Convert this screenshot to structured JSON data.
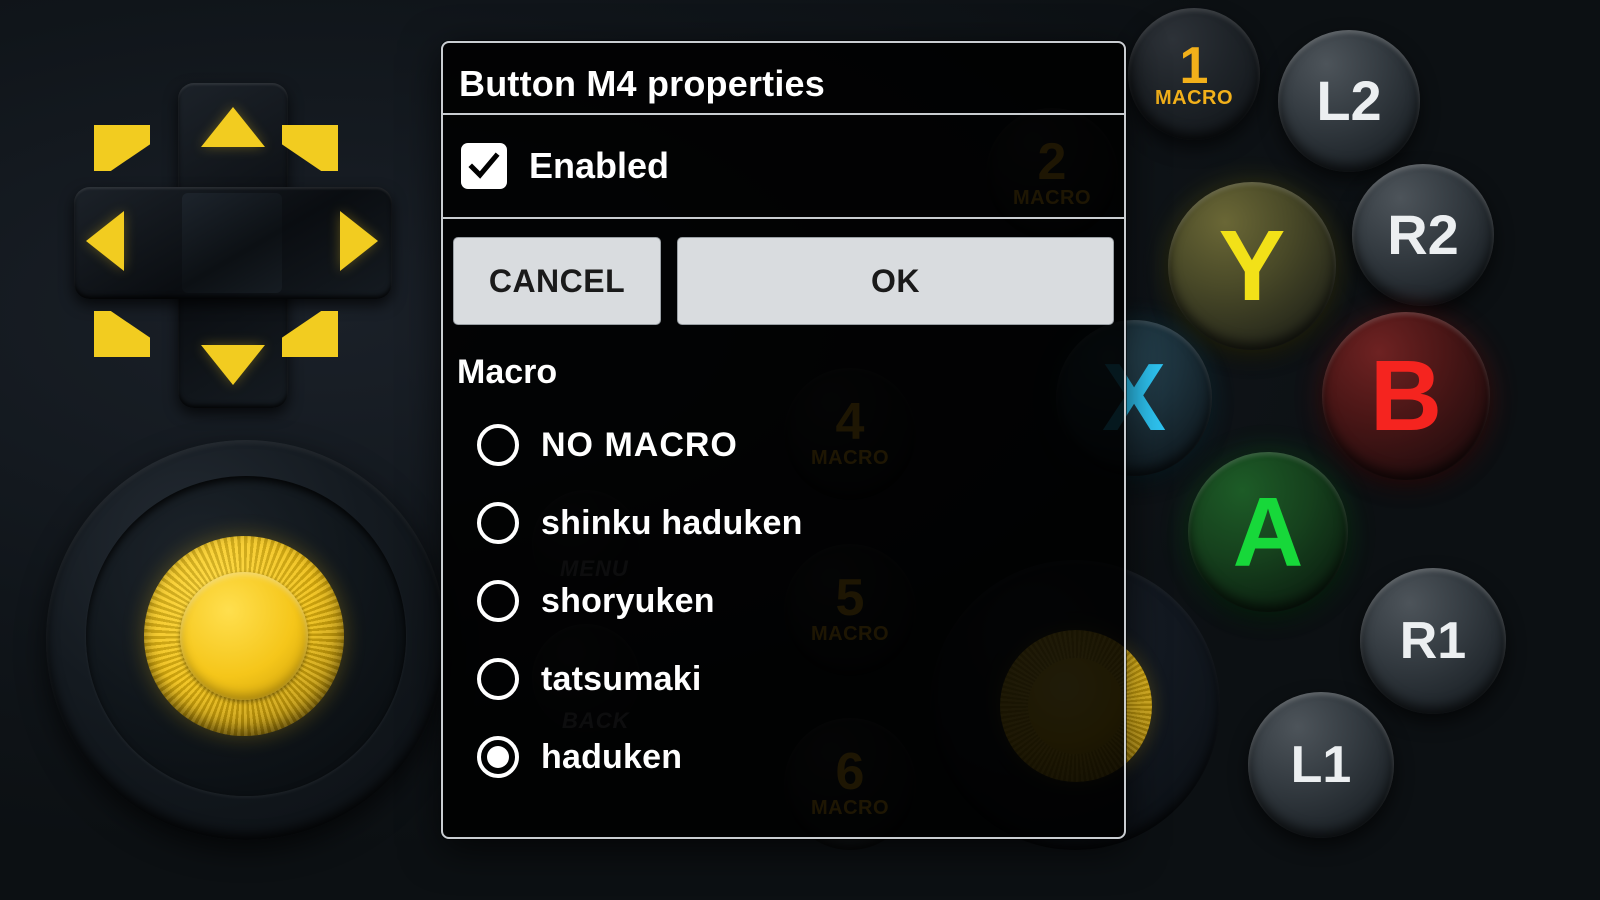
{
  "dialog": {
    "title": "Button M4 properties",
    "enabled": {
      "label": "Enabled",
      "checked": true,
      "icon": "checkmark-icon"
    },
    "buttons": {
      "cancel": "CANCEL",
      "ok": "OK"
    },
    "macro_heading": "Macro",
    "macro_options": [
      {
        "label": "NO MACRO",
        "selected": false,
        "caps": true
      },
      {
        "label": "shinku haduken",
        "selected": false,
        "caps": false
      },
      {
        "label": "shoryuken",
        "selected": false,
        "caps": false
      },
      {
        "label": "tatsumaki",
        "selected": false,
        "caps": false
      },
      {
        "label": "haduken",
        "selected": true,
        "caps": false
      }
    ],
    "selected_macro": "haduken"
  },
  "gamepad": {
    "dpad": {
      "name": "directional-pad",
      "arrows": [
        "up",
        "up-right",
        "right",
        "down-right",
        "down",
        "down-left",
        "left",
        "up-left"
      ],
      "arrow_color": "#f2cc20"
    },
    "left_stick": {
      "name": "left-thumbstick",
      "color": "#f5c61a"
    },
    "right_stick": {
      "name": "right-thumbstick",
      "color": "#f3c418"
    },
    "face_buttons": [
      {
        "label": "Y",
        "color": "#f2e118"
      },
      {
        "label": "B",
        "color": "#f5241f"
      },
      {
        "label": "A",
        "color": "#17d83a"
      },
      {
        "label": "X",
        "color": "#2ec4f2"
      }
    ],
    "shoulder_buttons": [
      {
        "label": "L2"
      },
      {
        "label": "R2"
      },
      {
        "label": "R1"
      },
      {
        "label": "L1"
      }
    ],
    "macro_buttons": [
      {
        "num": "1",
        "sub": "MACRO"
      },
      {
        "num": "2",
        "sub": "MACRO"
      },
      {
        "num": "4",
        "sub": "MACRO"
      },
      {
        "num": "5",
        "sub": "MACRO"
      },
      {
        "num": "6",
        "sub": "MACRO"
      }
    ],
    "system_buttons": [
      {
        "label": "MENU"
      },
      {
        "label": "BACK"
      }
    ]
  }
}
